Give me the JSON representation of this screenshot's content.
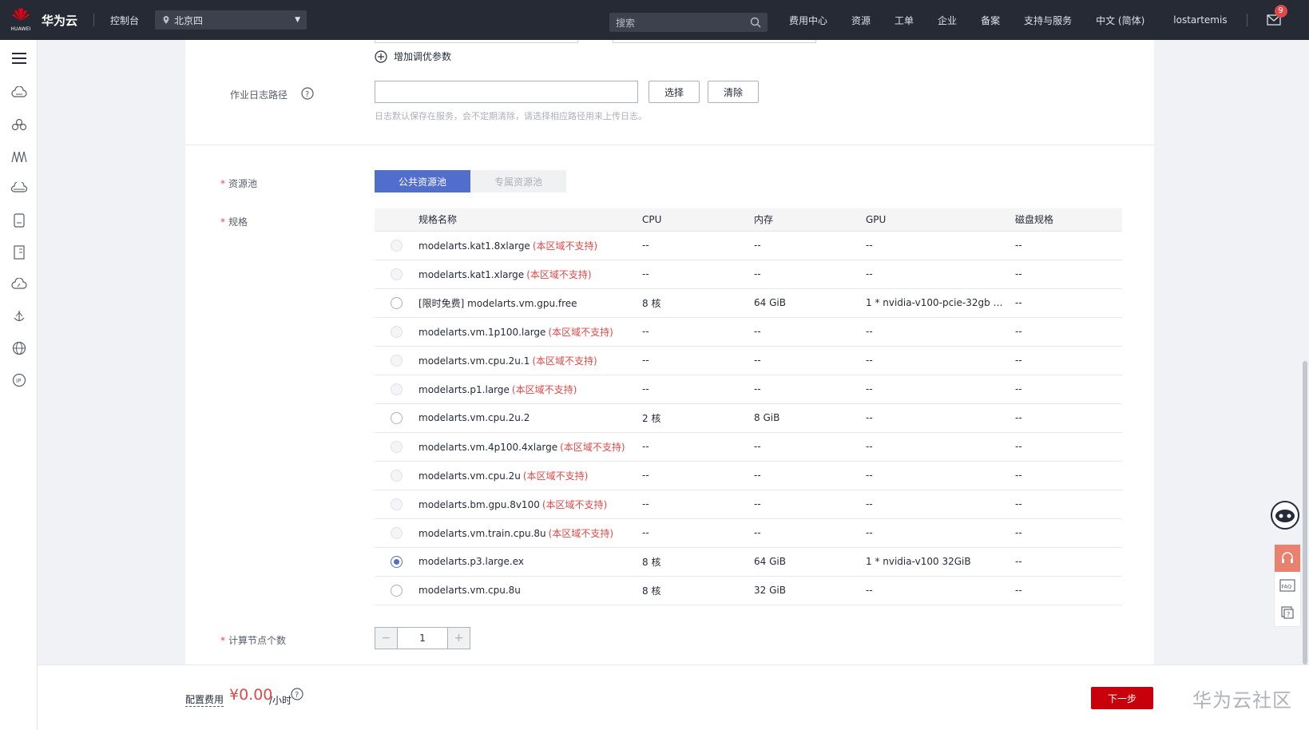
{
  "topbar": {
    "logo_text": "HUAWEI",
    "brand": "华为云",
    "console": "控制台",
    "region": "北京四",
    "search_placeholder": "搜索",
    "nav": [
      "费用中心",
      "资源",
      "工单",
      "企业",
      "备案",
      "支持与服务",
      "中文 (简体)"
    ],
    "username": "lostartemis",
    "mail_badge": "9"
  },
  "sidebar": {
    "icons": [
      "cloud-server-icon",
      "cluster-icon",
      "mountains-icon",
      "cloud-storage-icon",
      "database-icon",
      "document-icon",
      "cloud-icon",
      "anchor-icon",
      "globe-icon",
      "ip-icon"
    ]
  },
  "form": {
    "add_param": "增加调优参数",
    "log_path_label": "作业日志路径",
    "log_path_value": "",
    "select_button": "选择",
    "clear_button": "清除",
    "log_hint": "日志默认保存在服务，会不定期清除，请选择相应路径用来上传日志。",
    "pool_label": "资源池",
    "pool_public": "公共资源池",
    "pool_private": "专属资源池",
    "spec_label": "规格",
    "node_count_label": "计算节点个数",
    "node_count": "1",
    "minus": "−",
    "plus": "+",
    "required_mark": "*"
  },
  "table": {
    "headers": [
      "规格名称",
      "CPU",
      "内存",
      "GPU",
      "磁盘规格"
    ],
    "unsupported_label": "(本区域不支持)",
    "rows": [
      {
        "name": "modelarts.kat1.8xlarge",
        "unsupported": true,
        "cpu": "--",
        "mem": "--",
        "gpu": "--",
        "disk": "--",
        "state": "disabled"
      },
      {
        "name": "modelarts.kat1.xlarge",
        "unsupported": true,
        "cpu": "--",
        "mem": "--",
        "gpu": "--",
        "disk": "--",
        "state": "disabled"
      },
      {
        "name": "[限时免费] modelarts.vm.gpu.free",
        "unsupported": false,
        "cpu": "8 核",
        "mem": "64 GiB",
        "gpu": "1 * nvidia-v100-pcie-32gb 32...",
        "disk": "--",
        "state": "enabled"
      },
      {
        "name": "modelarts.vm.1p100.large",
        "unsupported": true,
        "cpu": "--",
        "mem": "--",
        "gpu": "--",
        "disk": "--",
        "state": "disabled"
      },
      {
        "name": "modelarts.vm.cpu.2u.1",
        "unsupported": true,
        "cpu": "--",
        "mem": "--",
        "gpu": "--",
        "disk": "--",
        "state": "disabled"
      },
      {
        "name": "modelarts.p1.large",
        "unsupported": true,
        "cpu": "--",
        "mem": "--",
        "gpu": "--",
        "disk": "--",
        "state": "disabled"
      },
      {
        "name": "modelarts.vm.cpu.2u.2",
        "unsupported": false,
        "cpu": "2 核",
        "mem": "8 GiB",
        "gpu": "--",
        "disk": "--",
        "state": "enabled"
      },
      {
        "name": "modelarts.vm.4p100.4xlarge",
        "unsupported": true,
        "cpu": "--",
        "mem": "--",
        "gpu": "--",
        "disk": "--",
        "state": "disabled"
      },
      {
        "name": "modelarts.vm.cpu.2u",
        "unsupported": true,
        "cpu": "--",
        "mem": "--",
        "gpu": "--",
        "disk": "--",
        "state": "disabled"
      },
      {
        "name": "modelarts.bm.gpu.8v100",
        "unsupported": true,
        "cpu": "--",
        "mem": "--",
        "gpu": "--",
        "disk": "--",
        "state": "disabled"
      },
      {
        "name": "modelarts.vm.train.cpu.8u",
        "unsupported": true,
        "cpu": "--",
        "mem": "--",
        "gpu": "--",
        "disk": "--",
        "state": "disabled"
      },
      {
        "name": "modelarts.p3.large.ex",
        "unsupported": false,
        "cpu": "8 核",
        "mem": "64 GiB",
        "gpu": "1 * nvidia-v100 32GiB",
        "disk": "--",
        "state": "checked"
      },
      {
        "name": "modelarts.vm.cpu.8u",
        "unsupported": false,
        "cpu": "8 核",
        "mem": "32 GiB",
        "gpu": "--",
        "disk": "--",
        "state": "enabled"
      }
    ]
  },
  "footer": {
    "fee_label": "配置费用",
    "fee_price": "¥0.00",
    "fee_unit": "/小时",
    "next_button": "下一步",
    "watermark": "华为云社区"
  },
  "floaters": {
    "faq": "FAQ"
  },
  "colors": {
    "topbar_bg": "#252a35",
    "accent_blue": "#526ecc",
    "error_red": "#e04848",
    "primary_red": "#c7000b"
  }
}
